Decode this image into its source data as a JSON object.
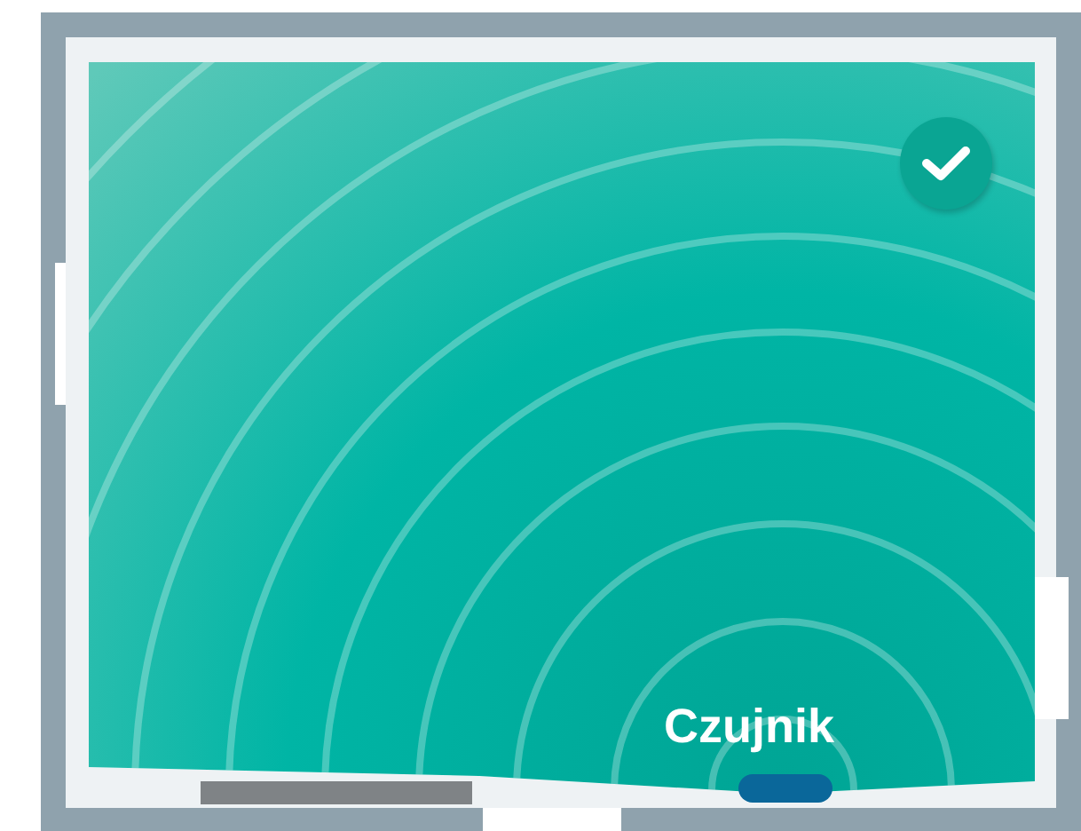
{
  "sensor": {
    "label": "Czujnik"
  },
  "status": {
    "checked": true
  }
}
